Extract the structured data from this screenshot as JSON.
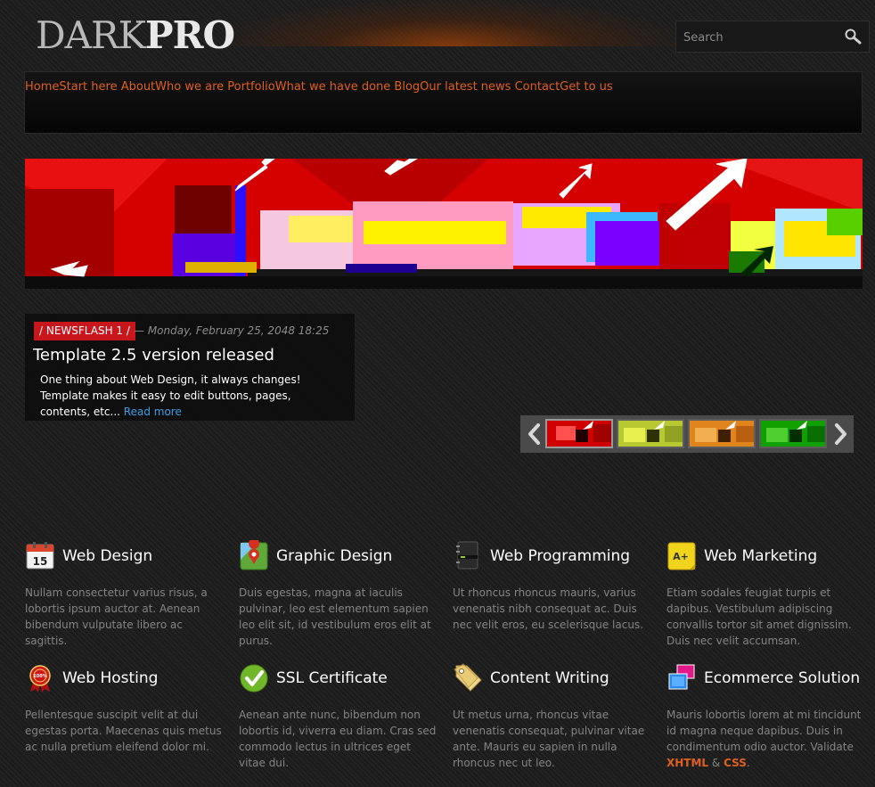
{
  "header": {
    "logo_dark": "DARK",
    "logo_pro": "PRO",
    "search_placeholder": "Search"
  },
  "nav": {
    "items": [
      {
        "label": "Home",
        "sub": "Start here"
      },
      {
        "label": "About",
        "sub": "Who we are"
      },
      {
        "label": "Portfolio",
        "sub": "What we have done"
      },
      {
        "label": "Blog",
        "sub": "Our latest news"
      },
      {
        "label": "Contact",
        "sub": "Get to us"
      }
    ]
  },
  "newsflash": {
    "badge": "/ NEWSFLASH 1 /",
    "date": "— Monday, February 25, 2048 18:25",
    "title": "Template 2.5 version released",
    "text": "One thing about Web Design, it always changes! Template makes it easy to edit buttons, pages, contents, etc...",
    "read_more": "Read more"
  },
  "features": [
    {
      "title": "Web Design",
      "icon": "calendar-icon",
      "text": "Nullam consectetur varius risus, a lobortis ipsum auctor at. Aenean bibendum vulputate libero ac sagittis."
    },
    {
      "title": "Graphic Design",
      "icon": "map-pin-icon",
      "text": "Duis egestas, magna at iaculis pulvinar, leo est elementum sapien leo elit sit, id vestibulum eros elit at purus."
    },
    {
      "title": "Web Programming",
      "icon": "notebook-icon",
      "text": "Ut rhoncus rhoncus mauris, varius venenatis nibh consequat ac. Duis nec velit eros, eu scelerisque lacus."
    },
    {
      "title": "Web Marketing",
      "icon": "grade-note-icon",
      "text": "Etiam sodales feugiat turpis et dapibus. Vestibulum adipiscing convallis tortor sit amet dignissim. Duis nec velit accumsan."
    },
    {
      "title": "Web Hosting",
      "icon": "guarantee-badge-icon",
      "text": "Pellentesque suscipit velit at dui egestas porta. Maecenas quis metus ac nulla pretium eleifend dolor mi."
    },
    {
      "title": "SSL Certificate",
      "icon": "checkmark-icon",
      "text": "Aenean ante nunc, bibendum non lobortis id, viverra eu diam. Cras sed commodo lectus in ultrices eget vitae dui."
    },
    {
      "title": "Content Writing",
      "icon": "price-tag-icon",
      "text": "Ut metus urna, rhoncus vitae venenatis consequat, pulvinar vitae ante. Mauris eu sapien in nulla rhoncus nec ut leo."
    },
    {
      "title": "Ecommerce Solution",
      "icon": "windows-icon",
      "text": "Mauris lobortis lorem at mi tincidunt id magna neque dapibus. Duis in condimentum odio auctor. Validate",
      "xhtml": "XHTML",
      "amp": " & ",
      "css": "CSS",
      "end": "."
    }
  ],
  "colors": {
    "accent": "#e0601e",
    "link": "#3d9ee6",
    "badge": "#c8161d"
  }
}
